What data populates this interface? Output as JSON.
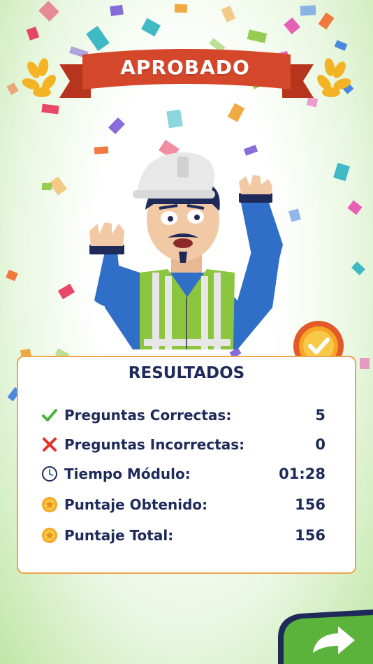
{
  "banner": {
    "title": "APROBADO"
  },
  "results": {
    "title": "RESULTADOS",
    "rows": [
      {
        "icon": "check-icon",
        "label": "Preguntas Correctas:",
        "value": "5"
      },
      {
        "icon": "cross-icon",
        "label": "Preguntas Incorrectas:",
        "value": "0"
      },
      {
        "icon": "clock-icon",
        "label": "Tiempo Módulo:",
        "value": "01:28"
      },
      {
        "icon": "star-coin-icon",
        "label": "Puntaje Obtenido:",
        "value": "156"
      },
      {
        "icon": "star-coin-icon",
        "label": "Puntaje Total:",
        "value": "156"
      }
    ]
  },
  "colors": {
    "ribbon": "#d4472a",
    "panel_border": "#f2a24a",
    "text": "#1e2a5a",
    "next_button": "#5cb33c",
    "check": "#4caf3f",
    "cross": "#e2322b"
  },
  "next_button": {
    "icon": "arrow-forward-icon"
  }
}
